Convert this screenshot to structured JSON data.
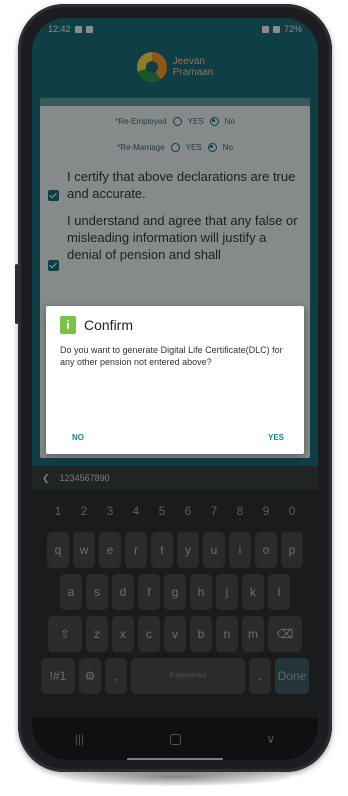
{
  "status_bar": {
    "time": "12:42",
    "battery": "72%"
  },
  "app": {
    "logo_line1": "Jeevan",
    "logo_line2": "Pramaan"
  },
  "form": {
    "row1_label": "*Re-Employed",
    "row1_yes": "YES",
    "row1_no": "No",
    "row2_label": "*Re-Marriage",
    "row2_yes": "YES",
    "row2_no": "No",
    "decl1": "I certify that above declarations are true and accurate.",
    "decl2": "I understand and agree that any false or misleading information will justify a denial of pension and shall"
  },
  "dialog": {
    "title": "Confirm",
    "message": "Do you want to generate Digital Life Certificate(DLC) for any other pension not entered above?",
    "no": "NO",
    "yes": "YES"
  },
  "keyboard": {
    "suggestion": "1234567890",
    "numbers": [
      "1",
      "2",
      "3",
      "4",
      "5",
      "6",
      "7",
      "8",
      "9",
      "0"
    ],
    "row1": [
      "q",
      "w",
      "e",
      "r",
      "t",
      "y",
      "u",
      "i",
      "o",
      "p"
    ],
    "row2": [
      "a",
      "s",
      "d",
      "f",
      "g",
      "h",
      "j",
      "k",
      "l"
    ],
    "row3": [
      "z",
      "x",
      "c",
      "v",
      "b",
      "n",
      "m"
    ],
    "sym": "!#1",
    "comma": ",",
    "space": "English(India)",
    "period": ".",
    "done": "Done"
  }
}
